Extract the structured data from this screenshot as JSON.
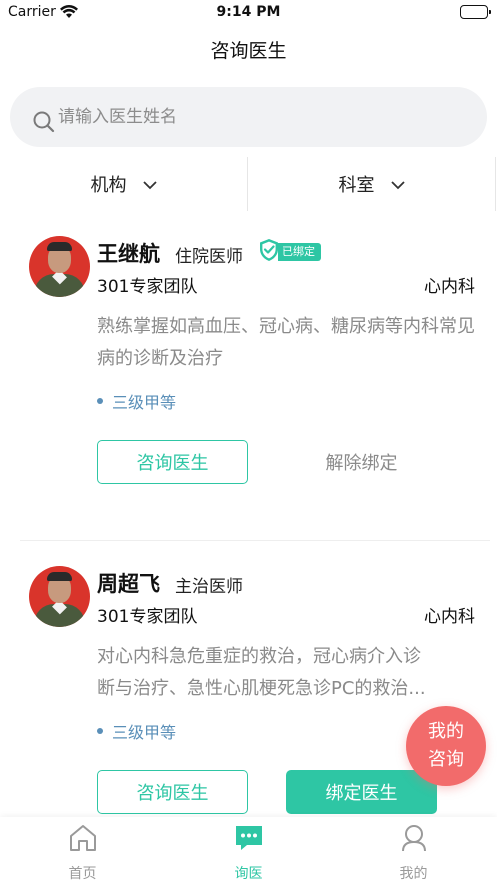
{
  "status_bar": {
    "carrier": "Carrier",
    "time": "9:14 PM"
  },
  "nav": {
    "title": "咨询医生"
  },
  "search": {
    "placeholder": "请输入医生姓名"
  },
  "filters": [
    {
      "label": "机构"
    },
    {
      "label": "科室"
    }
  ],
  "doctors": [
    {
      "name": "王继航",
      "title": "住院医师",
      "badge": "已绑定",
      "team": "301专家团队",
      "department": "心内科",
      "description": "熟练掌握如高血压、冠心病、糖尿病等内科常见病的诊断及治疗",
      "level": "三级甲等",
      "consult_label": "咨询医生",
      "secondary_label": "解除绑定"
    },
    {
      "name": "周超飞",
      "title": "主治医师",
      "team": "301专家团队",
      "department": "心内科",
      "description_line1": "对心内科急危重症的救治，冠心病介入诊",
      "description_line2": "断与治疗、急性心肌梗死急诊PC的救治...",
      "level": "三级甲等",
      "consult_label": "咨询医生",
      "secondary_label": "绑定医生"
    }
  ],
  "fab": {
    "line1": "我的",
    "line2": "咨询"
  },
  "tabs": [
    {
      "label": "首页",
      "icon": "home-icon"
    },
    {
      "label": "询医",
      "icon": "chat-icon",
      "active": true
    },
    {
      "label": "我的",
      "icon": "person-icon"
    }
  ],
  "colors": {
    "accent": "#2ec6a4",
    "fab": "#f26b6b",
    "level": "#5a8fb8"
  }
}
